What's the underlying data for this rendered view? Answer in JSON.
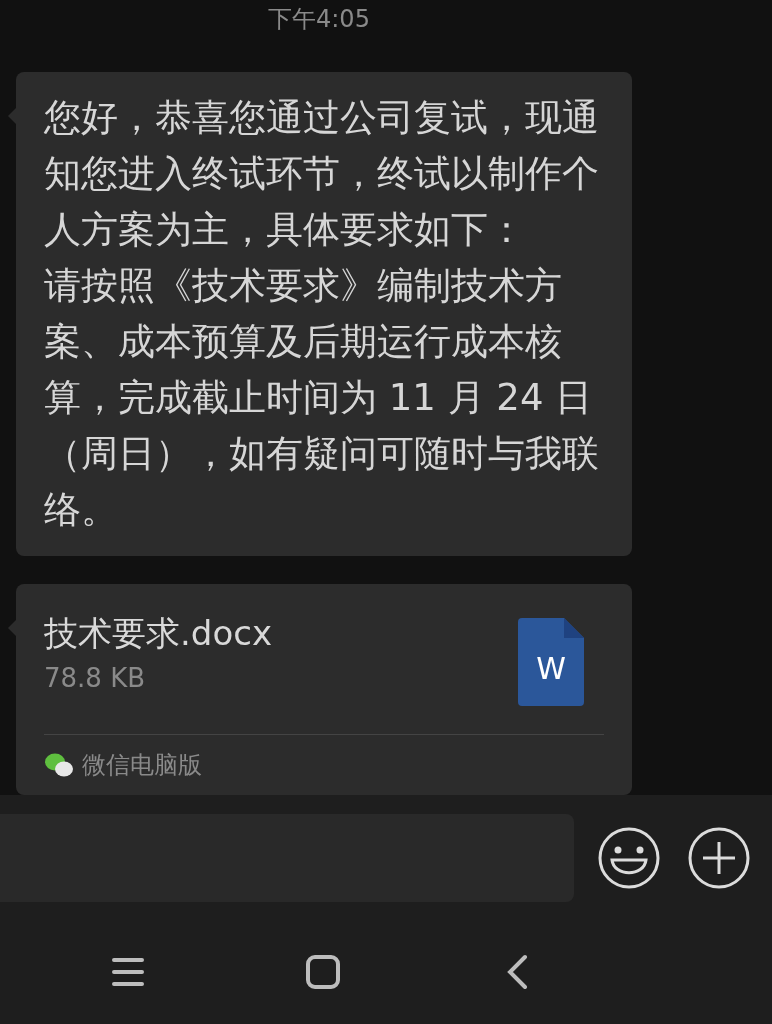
{
  "timestamp": "下午4:05",
  "messages": [
    {
      "kind": "text",
      "paragraphs": [
        "您好，恭喜您通过公司复试，现通知您进入终试环节，终试以制作个人方案为主，具体要求如下：",
        "请按照《技术要求》编制技术方案、成本预算及后期运行成本核算，完成截止时间为 11 月 24 日（周日），如有疑问可随时与我联络。"
      ]
    },
    {
      "kind": "file",
      "name": "技术要求.docx",
      "size": "78.8 KB",
      "icon_letter": "W",
      "source": "微信电脑版"
    }
  ]
}
